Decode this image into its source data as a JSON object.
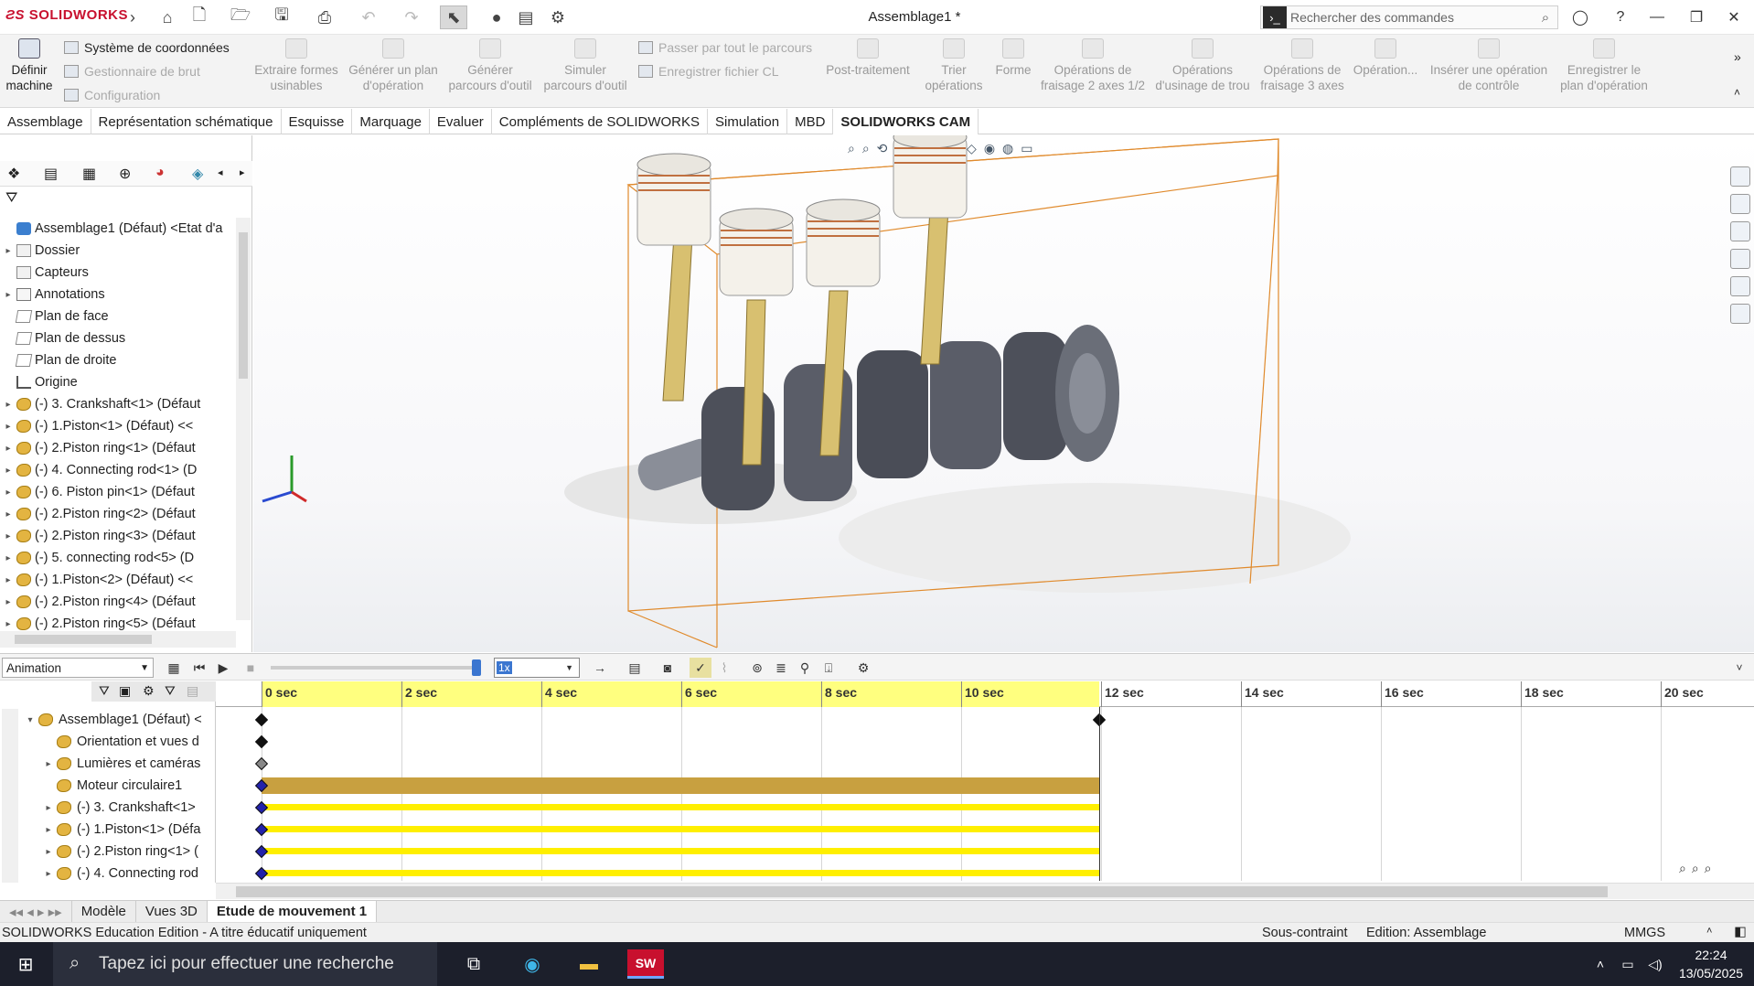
{
  "app": {
    "brand": "SOLIDWORKS",
    "window_title": "Assemblage1 *",
    "search_placeholder": "Rechercher des commandes"
  },
  "ribbon": {
    "define_machine": "Définir machine",
    "coord_system": "Système de coordonnées",
    "stock_manager": "Gestionnaire de brut",
    "configuration": "Configuration",
    "buttons": [
      "Extraire formes usinables",
      "Générer un plan d'opération",
      "Générer parcours d'outil",
      "Simuler parcours d'outil",
      "Post-traitement",
      "Trier opérations",
      "Forme",
      "Opérations de fraisage 2 axes 1/2",
      "Opérations d'usinage de trou",
      "Opérations de fraisage 3 axes",
      "Opération...",
      "Insérer une opération de contrôle",
      "Enregistrer le plan d'opération"
    ],
    "step_through": "Passer par tout le parcours",
    "save_cl": "Enregistrer fichier CL"
  },
  "tabs": [
    "Assemblage",
    "Représentation schématique",
    "Esquisse",
    "Marquage",
    "Evaluer",
    "Compléments de SOLIDWORKS",
    "Simulation",
    "MBD",
    "SOLIDWORKS CAM"
  ],
  "active_tab": "SOLIDWORKS CAM",
  "feature_tree": [
    {
      "label": "Assemblage1 (Défaut) <Etat d'a",
      "icon": "asm",
      "exp": ""
    },
    {
      "label": "Dossier",
      "icon": "folder",
      "exp": "▸"
    },
    {
      "label": "Capteurs",
      "icon": "folder",
      "exp": ""
    },
    {
      "label": "Annotations",
      "icon": "ann",
      "exp": "▸"
    },
    {
      "label": "Plan de face",
      "icon": "plane",
      "exp": ""
    },
    {
      "label": "Plan de dessus",
      "icon": "plane",
      "exp": ""
    },
    {
      "label": "Plan de droite",
      "icon": "plane",
      "exp": ""
    },
    {
      "label": "Origine",
      "icon": "orig",
      "exp": ""
    },
    {
      "label": "(-) 3. Crankshaft<1> (Défaut",
      "icon": "part",
      "exp": "▸"
    },
    {
      "label": "(-) 1.Piston<1> (Défaut) <<",
      "icon": "part",
      "exp": "▸"
    },
    {
      "label": "(-) 2.Piston ring<1> (Défaut",
      "icon": "part",
      "exp": "▸"
    },
    {
      "label": "(-) 4. Connecting rod<1> (D",
      "icon": "part",
      "exp": "▸"
    },
    {
      "label": "(-) 6. Piston pin<1> (Défaut",
      "icon": "part",
      "exp": "▸"
    },
    {
      "label": "(-) 2.Piston ring<2> (Défaut",
      "icon": "part",
      "exp": "▸"
    },
    {
      "label": "(-) 2.Piston ring<3> (Défaut",
      "icon": "part",
      "exp": "▸"
    },
    {
      "label": "(-) 5. connecting rod<5> (D",
      "icon": "part",
      "exp": "▸"
    },
    {
      "label": "(-) 1.Piston<2> (Défaut) <<",
      "icon": "part",
      "exp": "▸"
    },
    {
      "label": "(-) 2.Piston ring<4> (Défaut",
      "icon": "part",
      "exp": "▸"
    },
    {
      "label": "(-) 2.Piston ring<5> (Défaut",
      "icon": "part",
      "exp": "▸"
    }
  ],
  "animation": {
    "study_type": "Animation",
    "speed": "1x",
    "ticks": [
      "0 sec",
      "2 sec",
      "4 sec",
      "6 sec",
      "8 sec",
      "10 sec",
      "12 sec",
      "14 sec",
      "16 sec",
      "18 sec",
      "20 sec"
    ],
    "tree": [
      {
        "label": "Assemblage1 (Défaut) <",
        "exp": "▾",
        "bar": "none"
      },
      {
        "label": "Orientation et vues d",
        "exp": "",
        "bar": "none"
      },
      {
        "label": "Lumières et caméras",
        "exp": "▸",
        "bar": "none"
      },
      {
        "label": "Moteur circulaire1",
        "exp": "",
        "bar": "motor"
      },
      {
        "label": "(-) 3. Crankshaft<1>",
        "exp": "▸",
        "bar": "yellow"
      },
      {
        "label": "(-) 1.Piston<1> (Défa",
        "exp": "▸",
        "bar": "yellow"
      },
      {
        "label": "(-) 2.Piston ring<1> (",
        "exp": "▸",
        "bar": "yellow"
      },
      {
        "label": "(-) 4. Connecting rod",
        "exp": "▸",
        "bar": "yellow"
      }
    ]
  },
  "bottom_tabs": [
    "Modèle",
    "Vues 3D",
    "Etude de mouvement 1"
  ],
  "active_bottom_tab": "Etude de mouvement 1",
  "status": {
    "left": "SOLIDWORKS Education Edition - A titre éducatif uniquement",
    "constraint": "Sous-contraint",
    "edition": "Edition: Assemblage",
    "units": "MMGS"
  },
  "taskbar": {
    "search_placeholder": "Tapez ici pour effectuer une recherche",
    "time": "22:24",
    "date": "13/05/2025"
  },
  "colors": {
    "brand": "#c8102e",
    "timeline_yellow": "#ffff7f",
    "motor_bar": "#c8a040",
    "component_bar": "#ffef00",
    "bbox_orange": "#e08a2c"
  }
}
